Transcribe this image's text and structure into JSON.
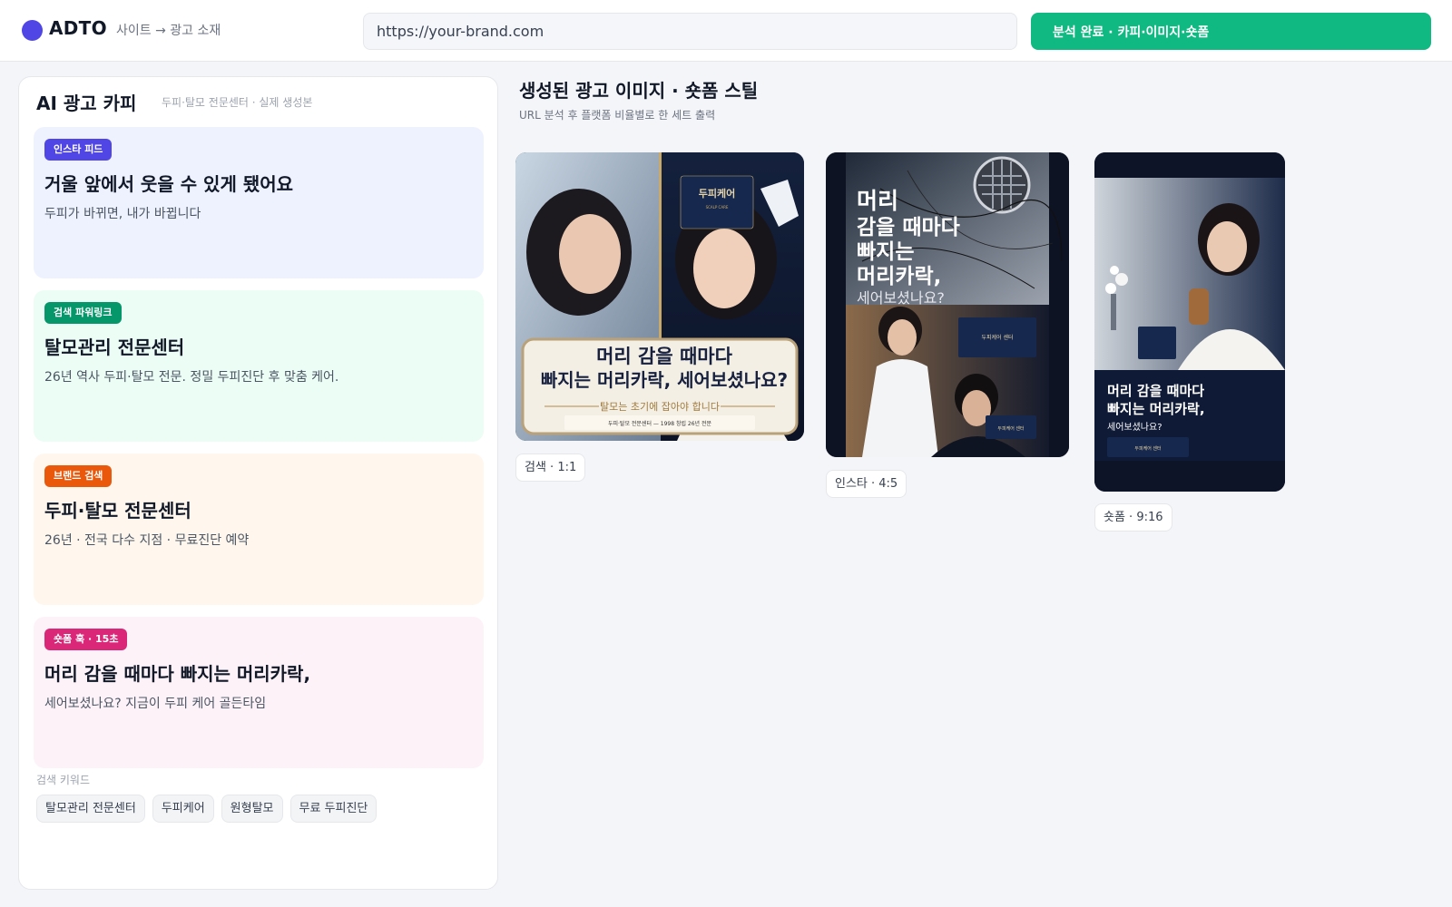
{
  "header": {
    "logo": "ADTO",
    "breadcrumb": "사이트 → 광고 소재",
    "url_value": "https://your-brand.com",
    "status_label": "분석 완료 · 카피·이미지·숏폼"
  },
  "copy_panel": {
    "title": "AI 광고 카피",
    "subtitle": "두피·탈모 전문센터 · 실제 생성본",
    "cards": [
      {
        "badge": "인스타 피드",
        "headline": "거울 앞에서 웃을 수 있게 됐어요",
        "body": "두피가 바뀌면, 내가 바뀝니다",
        "badge_color": "#4f46e5",
        "bg_color": "#eef2ff"
      },
      {
        "badge": "검색 파워링크",
        "headline": "탈모관리 전문센터",
        "body": "26년 역사 두피·탈모 전문. 정밀 두피진단 후 맞춤 케어.",
        "badge_color": "#059669",
        "bg_color": "#ecfdf5"
      },
      {
        "badge": "브랜드 검색",
        "headline": "두피·탈모 전문센터",
        "body": "26년 · 전국 다수 지점 · 무료진단 예약",
        "badge_color": "#ea580c",
        "bg_color": "#fff7ed"
      },
      {
        "badge": "숏폼 훅 · 15초",
        "headline": "머리 감을 때마다 빠지는 머리카락,",
        "body": "세어보셨나요? 지금이 두피 케어 골든타임",
        "badge_color": "#db2777",
        "bg_color": "#fdf2f8"
      }
    ],
    "keywords_label": "검색 키워드",
    "keywords": [
      "탈모관리 전문센터",
      "두피케어",
      "원형탈모",
      "무료 두피진단"
    ]
  },
  "gallery": {
    "title": "생성된 광고 이미지 · 숏폼 스틸",
    "subtitle": "URL 분석 후 플랫폼 비율별로 한 세트 출력",
    "items": [
      {
        "label": "검색 · 1:1",
        "panel_brand": "두피케어",
        "panel_brand_sub": "SCALP CARE",
        "headline_lines": [
          "머리 감을 때마다",
          "빠지는 머리카락, 세어보셨나요?"
        ],
        "tagline": "탈모는 초기에 잡아야 합니다",
        "footer": "두피·탈모 전문센터 — 1998 창립 26년 전문"
      },
      {
        "label": "인스타 · 4:5",
        "headline_lines": [
          "머리",
          "감을 때마다",
          "빠지는",
          "머리카락,",
          "세어보셨나요?"
        ],
        "sign1": "두피케어 센터",
        "sign2": "두피케어 센터"
      },
      {
        "label": "숏폼 · 9:16",
        "headline_lines": [
          "머리 감을 때마다",
          "빠지는 머리카락,",
          "세어보셨나요?"
        ],
        "sign": "두피케어 센터"
      }
    ]
  }
}
